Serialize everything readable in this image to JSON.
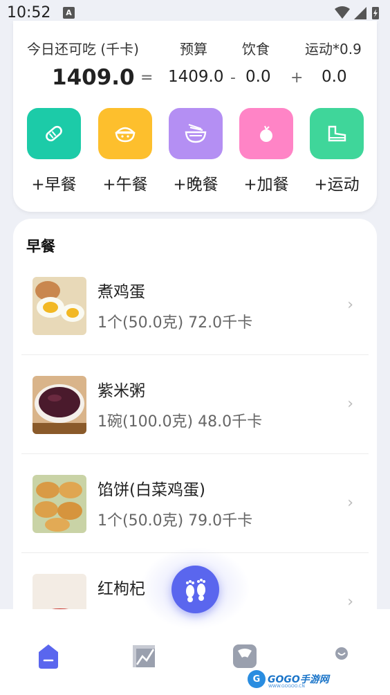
{
  "status_bar": {
    "time": "10:52",
    "notification_letter": "A"
  },
  "summary": {
    "headers": [
      "今日还可吃 (千卡)",
      "预算",
      "饮食",
      "运动*0.9"
    ],
    "remaining": "1409.0",
    "equals": "=",
    "budget": "1409.0",
    "minus": "-",
    "food": "0.0",
    "plus": "+",
    "exercise": "0.0"
  },
  "meal_buttons": [
    {
      "label": "+早餐",
      "icon": "bread-icon",
      "color": "#1ccba8"
    },
    {
      "label": "+午餐",
      "icon": "rice-bowl-icon",
      "color": "#fdbf2d"
    },
    {
      "label": "+晚餐",
      "icon": "noodle-bowl-icon",
      "color": "#b48ff3"
    },
    {
      "label": "+加餐",
      "icon": "fruit-icon",
      "color": "#ff84c6"
    },
    {
      "label": "+运动",
      "icon": "sneaker-icon",
      "color": "#3fd69a"
    }
  ],
  "breakfast": {
    "title": "早餐",
    "items": [
      {
        "name": "煮鸡蛋",
        "detail": "1个(50.0克) 72.0千卡"
      },
      {
        "name": "紫米粥",
        "detail": "1碗(100.0克) 48.0千卡"
      },
      {
        "name": "馅饼(白菜鸡蛋)",
        "detail": "1个(50.0克) 79.0千卡"
      },
      {
        "name": "红枸杞",
        "detail": ""
      }
    ]
  },
  "bottom_nav": {
    "items": [
      "home-icon",
      "chart-icon",
      "scale-icon",
      "profile-icon"
    ],
    "active_color": "#5a66ee",
    "inactive_color": "#9aa0ae"
  },
  "watermark": {
    "text": "GOGO手游网",
    "sub": "WWW.GOGOO.CN"
  }
}
